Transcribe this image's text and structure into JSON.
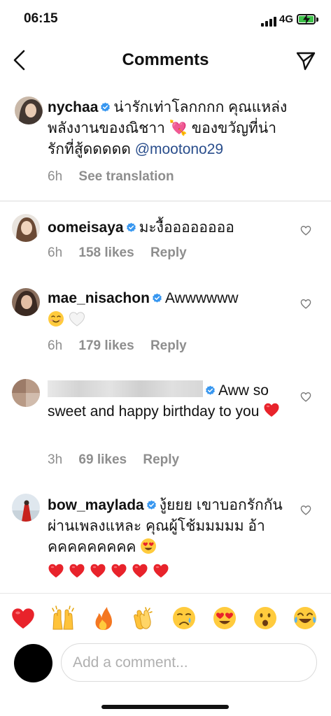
{
  "status_bar": {
    "time": "06:15",
    "network": "4G"
  },
  "header": {
    "title": "Comments"
  },
  "caption": {
    "username": "nychaa",
    "text": "น่ารักเท่าโลกกกก คุณแหล่งพลังงานของณิชาา",
    "emoji": "💘",
    "text2": " ของขวัญที่น่ารักที่สู้ดดดดด ",
    "mention": "@mootono29",
    "time": "6h",
    "see_translation": "See translation"
  },
  "comments": [
    {
      "username": "oomeisaya",
      "text": "มะงื้ออออออออ",
      "time": "6h",
      "likes": "158 likes",
      "reply": "Reply"
    },
    {
      "username": "mae_nisachon",
      "text": "Awwwwww",
      "time": "6h",
      "likes": "179 likes",
      "reply": "Reply"
    },
    {
      "username": "",
      "text": "Aww so sweet and happy birthday to you",
      "time": "3h",
      "likes": "69 likes",
      "reply": "Reply"
    },
    {
      "username": "bow_maylada",
      "text": "งู้ยยย เขาบอกรักกันผ่านเพลงแหละ คุณผู้โช้มมมมม อ้าคคคคคคคคค"
    }
  ],
  "reactions": [
    "red-heart",
    "raised-hands",
    "fire",
    "clapping-hands",
    "crying-face",
    "heart-eyes",
    "surprised-face",
    "tears-of-joy"
  ],
  "composer": {
    "placeholder": "Add a comment..."
  },
  "colors": {
    "verified": "#3897f0",
    "mention": "#2a4e8c",
    "secondary_text": "#8e8e8e",
    "battery": "#3ec34a"
  }
}
